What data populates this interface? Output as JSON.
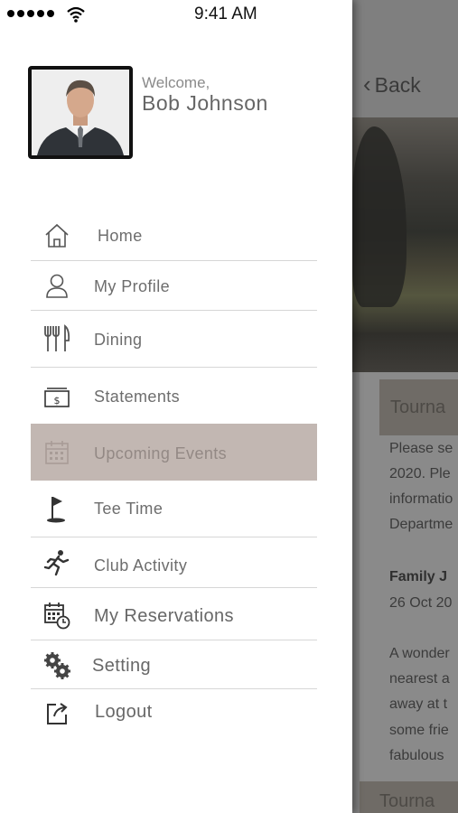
{
  "status_bar": {
    "time": "9:41 AM"
  },
  "background": {
    "back_label": "Back",
    "section_title": "Tourna",
    "body_lines": [
      "Please se",
      "2020. Ple",
      "informatio",
      "Departme"
    ],
    "event_name": "Family J",
    "event_date": "26 Oct 20",
    "desc_lines": [
      "A wonder",
      "nearest a",
      "away at t",
      "some frie",
      "fabulous"
    ],
    "bottom_title": "Tourna"
  },
  "profile": {
    "welcome": "Welcome,",
    "name": "Bob Johnson"
  },
  "menu": [
    {
      "label": "Home",
      "icon": "home-icon"
    },
    {
      "label": "My Profile",
      "icon": "profile-icon"
    },
    {
      "label": "Dining",
      "icon": "dining-icon"
    },
    {
      "label": "Statements",
      "icon": "statements-icon"
    },
    {
      "label": "Upcoming Events",
      "icon": "calendar-icon",
      "active": true
    },
    {
      "label": "Tee Time",
      "icon": "golf-flag-icon"
    },
    {
      "label": "Club Activity",
      "icon": "running-icon"
    },
    {
      "label": "My Reservations",
      "icon": "reservations-icon"
    },
    {
      "label": "Setting",
      "icon": "gears-icon"
    },
    {
      "label": "Logout",
      "icon": "logout-icon"
    }
  ],
  "colors": {
    "active_bg": "#c2b7b2",
    "divider": "#d6d6d6",
    "overlay": "#7f7f7f"
  }
}
